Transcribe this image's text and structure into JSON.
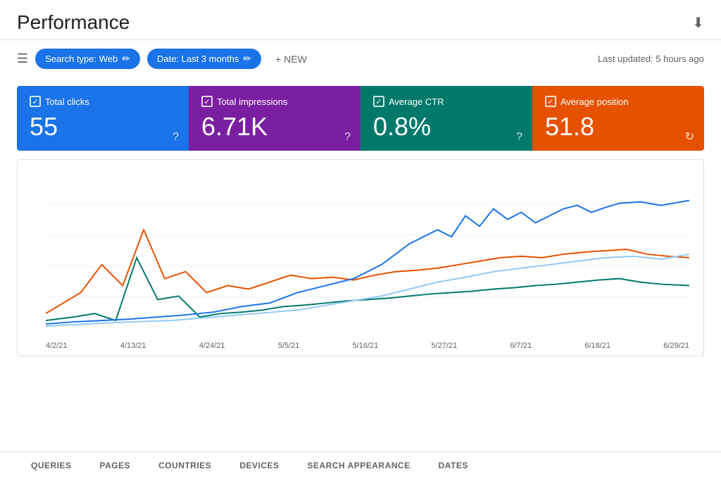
{
  "header": {
    "title": "Performance",
    "last_updated": "Last updated: 5 hours ago"
  },
  "toolbar": {
    "filter_icon_label": "≡",
    "chips": [
      {
        "id": "search-type",
        "label": "Search type: Web",
        "editable": true
      },
      {
        "id": "date",
        "label": "Date: Last 3 months",
        "editable": true
      }
    ],
    "new_button": "+ NEW"
  },
  "metrics": [
    {
      "id": "total-clicks",
      "label": "Total clicks",
      "value": "55",
      "color": "blue",
      "checked": true
    },
    {
      "id": "total-impressions",
      "label": "Total impressions",
      "value": "6.71K",
      "color": "purple",
      "checked": true
    },
    {
      "id": "average-ctr",
      "label": "Average CTR",
      "value": "0.8%",
      "color": "teal",
      "checked": true
    },
    {
      "id": "average-position",
      "label": "Average position",
      "value": "51.8",
      "color": "orange",
      "checked": true
    }
  ],
  "chart": {
    "x_labels": [
      "4/2/21",
      "4/13/21",
      "4/24/21",
      "5/5/21",
      "5/16/21",
      "5/27/21",
      "6/7/21",
      "6/18/21",
      "6/29/21"
    ]
  },
  "bottom_tabs": [
    {
      "id": "queries",
      "label": "QUERIES",
      "active": false
    },
    {
      "id": "pages",
      "label": "PAGES",
      "active": false
    },
    {
      "id": "countries",
      "label": "COUNTRIES",
      "active": false
    },
    {
      "id": "devices",
      "label": "DEVICES",
      "active": false
    },
    {
      "id": "search-appearance",
      "label": "SEARCH APPEARANCE",
      "active": false
    },
    {
      "id": "dates",
      "label": "DATES",
      "active": false
    }
  ]
}
